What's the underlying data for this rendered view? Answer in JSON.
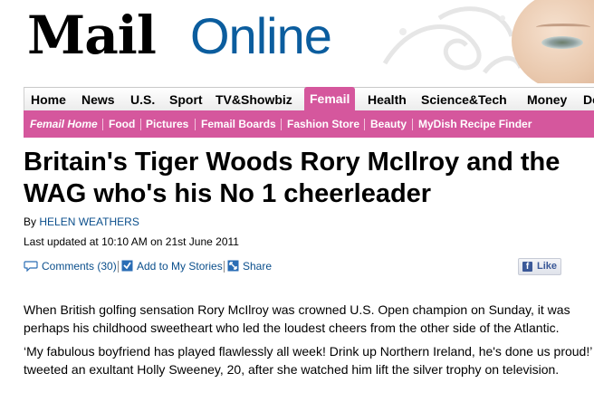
{
  "masthead": {
    "logo_main": "Mail",
    "logo_sub": "Online"
  },
  "nav": {
    "items": [
      {
        "label": "Home"
      },
      {
        "label": "News"
      },
      {
        "label": "U.S."
      },
      {
        "label": "Sport"
      },
      {
        "label": "TV&Showbiz"
      },
      {
        "label": "Femail",
        "active": true
      },
      {
        "label": "Health"
      },
      {
        "label": "Science&Tech"
      },
      {
        "label": "Money"
      },
      {
        "label": "De"
      }
    ]
  },
  "subnav": {
    "items": [
      {
        "label": "Femail Home"
      },
      {
        "label": "Food"
      },
      {
        "label": "Pictures"
      },
      {
        "label": "Femail Boards"
      },
      {
        "label": "Fashion Store"
      },
      {
        "label": "Beauty"
      },
      {
        "label": "MyDish Recipe Finder"
      }
    ]
  },
  "article": {
    "headline": "Britain's Tiger Woods Rory McIlroy and the WAG who's his No 1 cheerleader",
    "byline_prefix": "By",
    "author": "HELEN WEATHERS",
    "updated": "Last updated at 10:10 AM on 21st June 2011",
    "paragraphs": [
      "When British golfing sensation Rory McIlroy was crowned U.S. Open champion on Sunday, it was perhaps his childhood sweetheart who led the loudest cheers from the other side of the Atlantic.",
      "‘My fabulous boyfriend has played flawlessly all week! Drink up Northern Ireland, he's done us proud!’ tweeted an exultant Holly Sweeney, 20, after she watched him lift the silver trophy on television."
    ]
  },
  "actions": {
    "comments": "Comments (30)",
    "add_stories": "Add to My Stories",
    "share": "Share",
    "like": "Like"
  },
  "colors": {
    "accent": "#d5579d",
    "link": "#0b4f8c",
    "logo_blue": "#0b5d9e"
  }
}
